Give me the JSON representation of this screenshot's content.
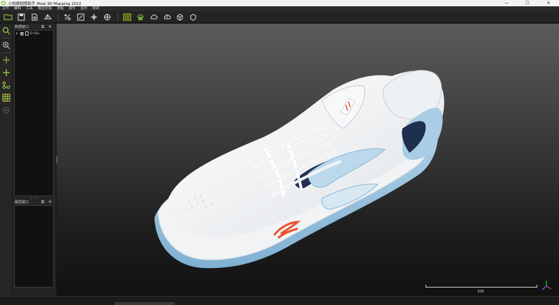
{
  "window": {
    "title": "小稻瓶稻图助手 iReal 3D Mapping 2022",
    "controls": {
      "minimize": "—",
      "maximize": "☐",
      "close": "✕"
    }
  },
  "menu": [
    "文件",
    "编辑",
    "工具",
    "模型处理",
    "流程",
    "插件",
    "显示",
    "帮助"
  ],
  "toolbar": {
    "groups": [
      [
        "open-folder-icon",
        "save-icon",
        "new-document-icon",
        "transform-icon"
      ],
      [
        "point-pick-icon",
        "measure-icon",
        "axis-move-icon",
        "rotate-icon"
      ],
      [
        "mesh-green-icon",
        "mesh-fill-icon",
        "cloud-icon",
        "cloud-sync-icon",
        "cube-edit-icon",
        "cube-icon"
      ]
    ]
  },
  "left_tools": [
    "search-icon",
    "zoom-region-icon",
    "crosshair-icon",
    "crosshair-move-icon",
    "connect-nodes-icon",
    "grid-icon",
    "target-icon"
  ],
  "data_panel": {
    "title": "数据窗口",
    "float_icon": "⧉",
    "close_icon": "✕",
    "tree": [
      {
        "toggle": "▸",
        "checked": true,
        "label": "D:\\Da..."
      }
    ]
  },
  "property_panel": {
    "title": "属性窗口",
    "float_icon": "⧉",
    "close_icon": "✕"
  },
  "viewport": {
    "scale_label": "100",
    "colors": {
      "upper": "#aecde3",
      "sole": "#9cc3de",
      "navy": "#1f2f4f",
      "logo": "#e8512a",
      "white": "#f4f5f6"
    }
  },
  "status": {
    "coords": ""
  }
}
